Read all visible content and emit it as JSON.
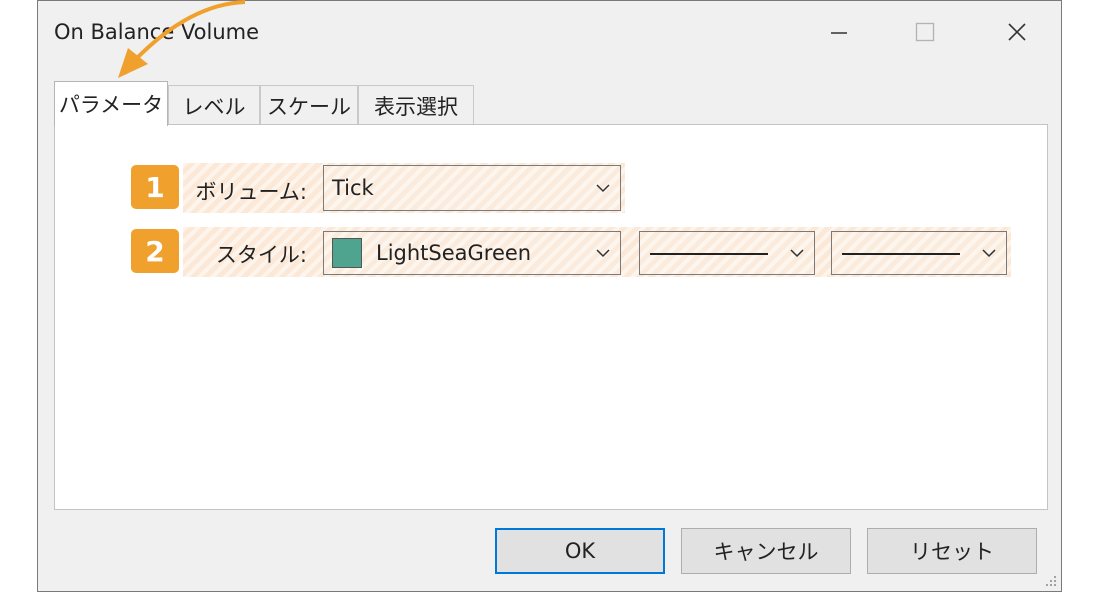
{
  "window": {
    "title": "On Balance Volume",
    "controls": {
      "minimize": "minimize",
      "maximize": "maximize",
      "close": "close"
    }
  },
  "tabs": [
    {
      "label": "パラメータ",
      "active": true
    },
    {
      "label": "レベル",
      "active": false
    },
    {
      "label": "スケール",
      "active": false
    },
    {
      "label": "表示選択",
      "active": false
    }
  ],
  "params": {
    "volume": {
      "badge": "1",
      "label": "ボリューム:",
      "value": "Tick"
    },
    "style": {
      "badge": "2",
      "label": "スタイル:",
      "color_name": "LightSeaGreen",
      "color_hex": "#4fa48f"
    }
  },
  "buttons": {
    "ok": "OK",
    "cancel": "キャンセル",
    "reset": "リセット"
  },
  "colors": {
    "accent": "#f0a02c",
    "highlight": "#fbe8d6",
    "focus": "#0078d7"
  }
}
